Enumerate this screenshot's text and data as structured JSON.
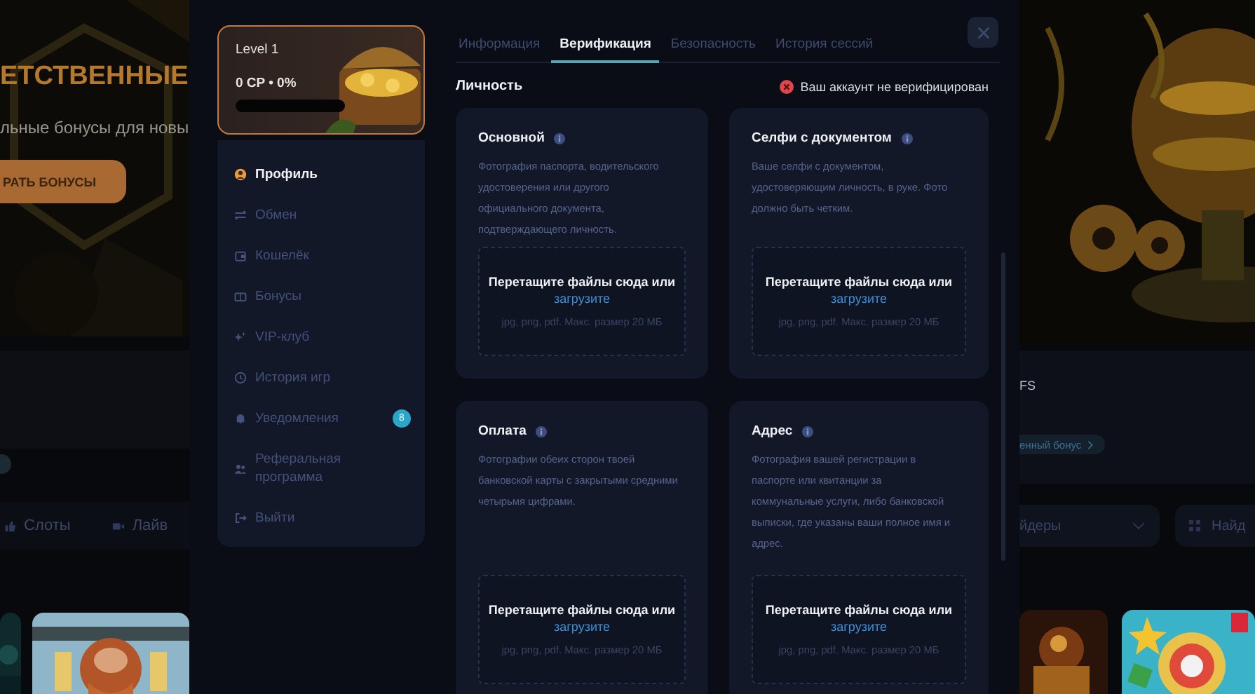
{
  "backdrop": {
    "left": {
      "headline": "ЕТСТВЕННЫЕ",
      "subtitle": "льные бонусы для новы",
      "button": "РАТЬ БОНУСЫ",
      "tabs": [
        "Слоты",
        "Лайв"
      ]
    },
    "right": {
      "promo_text": "FS",
      "bonus_link": "енный бонус",
      "providers_dropdown": "йдеры",
      "search": {
        "placeholder": "Найд"
      }
    }
  },
  "sidebar": {
    "level_card": {
      "title": "Level 1",
      "points": "0 CP • 0%",
      "progress": {
        "level": 0
      }
    },
    "items": [
      {
        "label": "Профиль",
        "selected": true
      },
      {
        "label": "Обмен",
        "selected": false
      },
      {
        "label": "Кошелёк",
        "selected": false
      },
      {
        "label": "Бонусы",
        "selected": false
      },
      {
        "label": "VIP-клуб",
        "selected": false
      },
      {
        "label": "История игр",
        "selected": false
      },
      {
        "label": "Уведомления",
        "selected": false,
        "badge": "8"
      },
      {
        "label": "Реферальная программа",
        "selected": false
      },
      {
        "label": "Выйти",
        "selected": false
      }
    ]
  },
  "tabs": [
    {
      "label": "Информация",
      "selected": false
    },
    {
      "label": "Верификация",
      "selected": true
    },
    {
      "label": "Безопасность",
      "selected": false
    },
    {
      "label": "История сессий",
      "selected": false
    }
  ],
  "section": {
    "title": "Личность",
    "status": "Ваш аккаунт не верифицирован"
  },
  "cards": [
    {
      "title": "Основной",
      "description": "Фотография паспорта, водительского удостоверения или другого официального документа, подтверждающего личность.",
      "dropzone": {
        "prompt": "Перетащите файлы сюда или",
        "link": "загрузите",
        "hint": "jpg, png, pdf. Макс. размер 20 МБ"
      }
    },
    {
      "title": "Селфи с документом",
      "description": "Ваше селфи с документом, удостоверяющим личность, в руке. Фото должно быть четким.",
      "dropzone": {
        "prompt": "Перетащите файлы сюда или",
        "link": "загрузите",
        "hint": "jpg, png, pdf. Макс. размер 20 МБ"
      }
    },
    {
      "title": "Оплата",
      "description": "Фотографии обеих сторон твоей банковской карты с закрытыми средними четырьмя цифрами.",
      "dropzone": {
        "prompt": "Перетащите файлы сюда или",
        "link": "загрузите",
        "hint": "jpg, png, pdf. Макс. размер 20 МБ"
      }
    },
    {
      "title": "Адрес",
      "description": "Фотография вашей регистрации в паспорте или квитанции за коммунальные услуги, либо банковской выписки, где указаны ваши полное имя и адрес.",
      "dropzone": {
        "prompt": "Перетащите файлы сюда или",
        "link": "загрузите",
        "hint": "jpg, png, pdf. Макс. размер 20 МБ"
      }
    }
  ]
}
